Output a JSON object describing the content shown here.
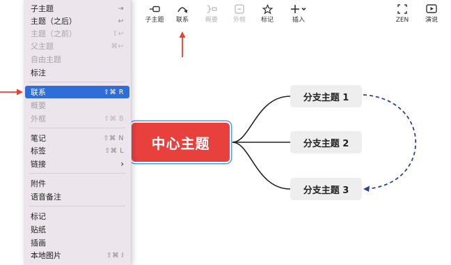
{
  "toolbar": {
    "items": [
      {
        "label": "子主题",
        "icon": "subtopic-icon",
        "disabled": false
      },
      {
        "label": "联系",
        "icon": "relationship-icon",
        "disabled": false
      },
      {
        "label": "概要",
        "icon": "summary-bracket-icon",
        "disabled": true
      },
      {
        "label": "外框",
        "icon": "boundary-icon",
        "disabled": true
      },
      {
        "label": "标记",
        "icon": "star-icon",
        "disabled": false
      },
      {
        "label": "插入",
        "icon": "plus-chevron-icon",
        "disabled": false
      },
      {
        "label": "ZEN",
        "icon": "zen-mode-icon",
        "disabled": false
      },
      {
        "label": "演说",
        "icon": "pitch-play-icon",
        "disabled": false
      }
    ]
  },
  "menu": {
    "items": [
      {
        "label": "子主题",
        "shortcut": "⇥",
        "disabled": false
      },
      {
        "label": "主题（之后）",
        "shortcut": "↩",
        "disabled": false
      },
      {
        "label": "主题（之前）",
        "shortcut": "⇧↩",
        "disabled": true
      },
      {
        "label": "父主题",
        "shortcut": "⌘↩",
        "disabled": true
      },
      {
        "label": "自由主题",
        "shortcut": "",
        "disabled": true
      },
      {
        "label": "标注",
        "shortcut": "",
        "disabled": false
      },
      {
        "label": "联系",
        "shortcut": "⇧⌘ R",
        "disabled": false,
        "selected": true
      },
      {
        "label": "概要",
        "shortcut": "",
        "disabled": true
      },
      {
        "label": "外框",
        "shortcut": "⇧⌘ B",
        "disabled": true
      },
      {
        "label": "笔记",
        "shortcut": "⇧⌘ N",
        "disabled": false
      },
      {
        "label": "标签",
        "shortcut": "⇧⌘ L",
        "disabled": false
      },
      {
        "label": "链接",
        "shortcut": "›",
        "disabled": false
      },
      {
        "label": "附件",
        "shortcut": "",
        "disabled": false
      },
      {
        "label": "语音备注",
        "shortcut": "",
        "disabled": false
      },
      {
        "label": "标记",
        "shortcut": "",
        "disabled": false
      },
      {
        "label": "贴纸",
        "shortcut": "",
        "disabled": false
      },
      {
        "label": "插画",
        "shortcut": "",
        "disabled": false
      },
      {
        "label": "本地图片",
        "shortcut": "⇧⌘ I",
        "disabled": false
      }
    ]
  },
  "mindmap": {
    "central": "中心主题",
    "branches": [
      "分支主题 1",
      "分支主题 2",
      "分支主题 3"
    ]
  },
  "colors": {
    "central_fill": "#e8413d",
    "selection_outline": "#4b9cf0",
    "menu_highlight": "#2f6ed6",
    "annotation_arrow": "#e8412f",
    "relationship_line": "#2f3f9a"
  }
}
